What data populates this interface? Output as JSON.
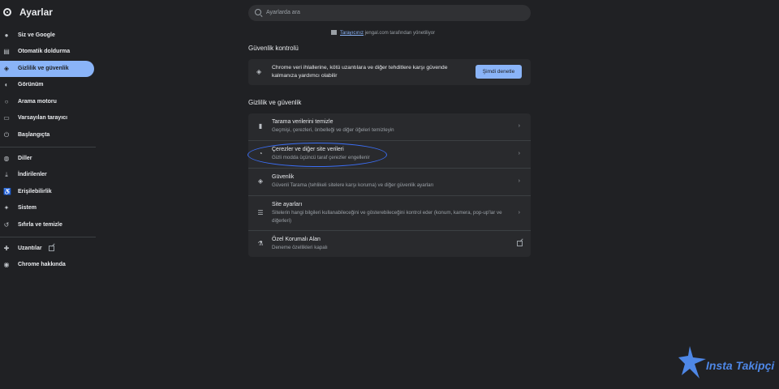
{
  "app": {
    "title": "Ayarlar"
  },
  "search": {
    "placeholder": "Ayarlarda ara"
  },
  "sidebar": {
    "items": [
      {
        "label": "Siz ve Google",
        "icon": "person-icon"
      },
      {
        "label": "Otomatik doldurma",
        "icon": "autofill-icon"
      },
      {
        "label": "Gizlilik ve güvenlik",
        "icon": "shield-icon",
        "active": true
      },
      {
        "label": "Görünüm",
        "icon": "palette-icon"
      },
      {
        "label": "Arama motoru",
        "icon": "search-icon"
      },
      {
        "label": "Varsayılan tarayıcı",
        "icon": "browser-icon"
      },
      {
        "label": "Başlangıçta",
        "icon": "power-icon"
      },
      {
        "label": "Diller",
        "icon": "globe-icon"
      },
      {
        "label": "İndirilenler",
        "icon": "download-icon"
      },
      {
        "label": "Erişilebilirlik",
        "icon": "accessibility-icon"
      },
      {
        "label": "Sistem",
        "icon": "wrench-icon"
      },
      {
        "label": "Sıfırla ve temizle",
        "icon": "history-icon"
      },
      {
        "label": "Uzantılar",
        "icon": "puzzle-icon"
      },
      {
        "label": "Chrome hakkında",
        "icon": "chrome-icon"
      }
    ]
  },
  "managed": {
    "link": "Tarayıcınız",
    "text": " jengal.com tarafından yönetiliyor"
  },
  "safety": {
    "title": "Güvenlik kontrolü",
    "description": "Chrome veri ihlallerine, kötü uzantılara ve diğer tehditlere karşı güvende kalmanıza yardımcı olabilir",
    "button": "Şimdi denetle"
  },
  "privacy": {
    "title": "Gizlilik ve güvenlik",
    "rows": [
      {
        "title": "Tarama verilerini temizle",
        "subtitle": "Geçmişi, çerezleri, önbelleği ve diğer öğeleri temizleyin",
        "icon": "trash-icon"
      },
      {
        "title": "Çerezler ve diğer site verileri",
        "subtitle": "Gizli modda üçüncü taraf çerezler engellenir",
        "icon": "cookie-icon"
      },
      {
        "title": "Güvenlik",
        "subtitle": "Güvenli Tarama (tehlikeli sitelere karşı koruma) ve diğer güvenlik ayarları",
        "icon": "shield-icon"
      },
      {
        "title": "Site ayarları",
        "subtitle": "Sitelerin hangi bilgileri kullanabileceğini ve gösterebileceğini kontrol eder (konum, kamera, pop-up'lar ve diğerleri)",
        "icon": "sliders-icon"
      },
      {
        "title": "Özel Korumalı Alan",
        "subtitle": "Deneme özellikleri kapalı",
        "icon": "flask-icon"
      }
    ]
  },
  "watermark": {
    "text": "Insta Takipçi"
  },
  "colors": {
    "accent": "#8ab4f8",
    "background": "#202124",
    "card": "#292a2d",
    "highlight": "#3b6ef5"
  }
}
